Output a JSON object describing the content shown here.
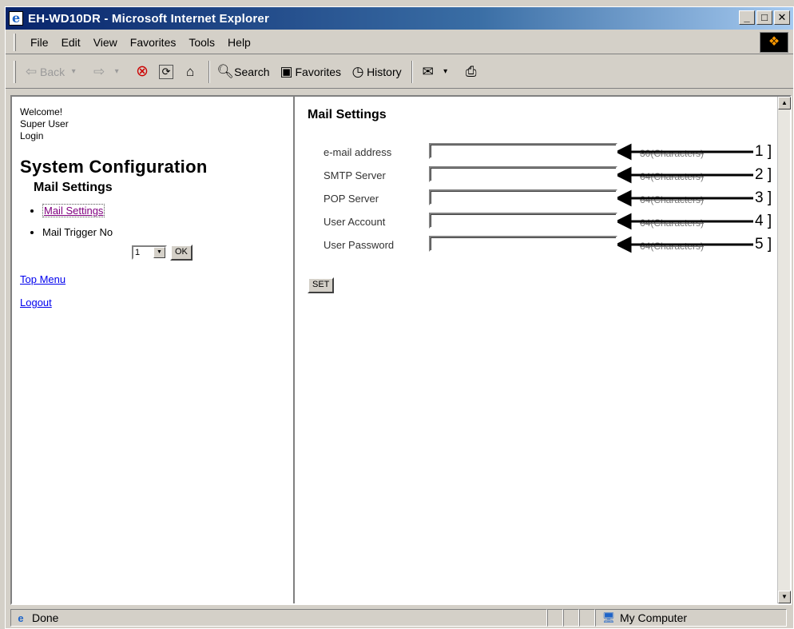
{
  "window": {
    "title": "EH-WD10DR - Microsoft Internet Explorer"
  },
  "menu": [
    "File",
    "Edit",
    "View",
    "Favorites",
    "Tools",
    "Help"
  ],
  "toolbar": {
    "back": "Back",
    "search": "Search",
    "favorites": "Favorites",
    "history": "History"
  },
  "sidebar": {
    "welcome": "Welcome!",
    "user": "Super User",
    "login": "Login",
    "section_title": "System Configuration",
    "subsection": "Mail Settings",
    "nav": [
      "Mail Settings",
      "Mail Trigger No"
    ],
    "trigger_select_value": "1",
    "ok_label": "OK",
    "top_menu": "Top Menu",
    "logout": "Logout"
  },
  "main": {
    "title": "Mail Settings",
    "fields": [
      {
        "label": "e-mail address",
        "maxlen": "30(Characters)",
        "callout": "1 ]"
      },
      {
        "label": "SMTP Server",
        "maxlen": "64(Characters)",
        "callout": "2 ]"
      },
      {
        "label": "POP Server",
        "maxlen": "64(Characters)",
        "callout": "3 ]"
      },
      {
        "label": "User Account",
        "maxlen": "64(Characters)",
        "callout": "4 ]"
      },
      {
        "label": "User Password",
        "maxlen": "64(Characters)",
        "callout": "5 ]"
      }
    ],
    "set_label": "SET"
  },
  "status": {
    "text": "Done",
    "zone": "My Computer"
  }
}
